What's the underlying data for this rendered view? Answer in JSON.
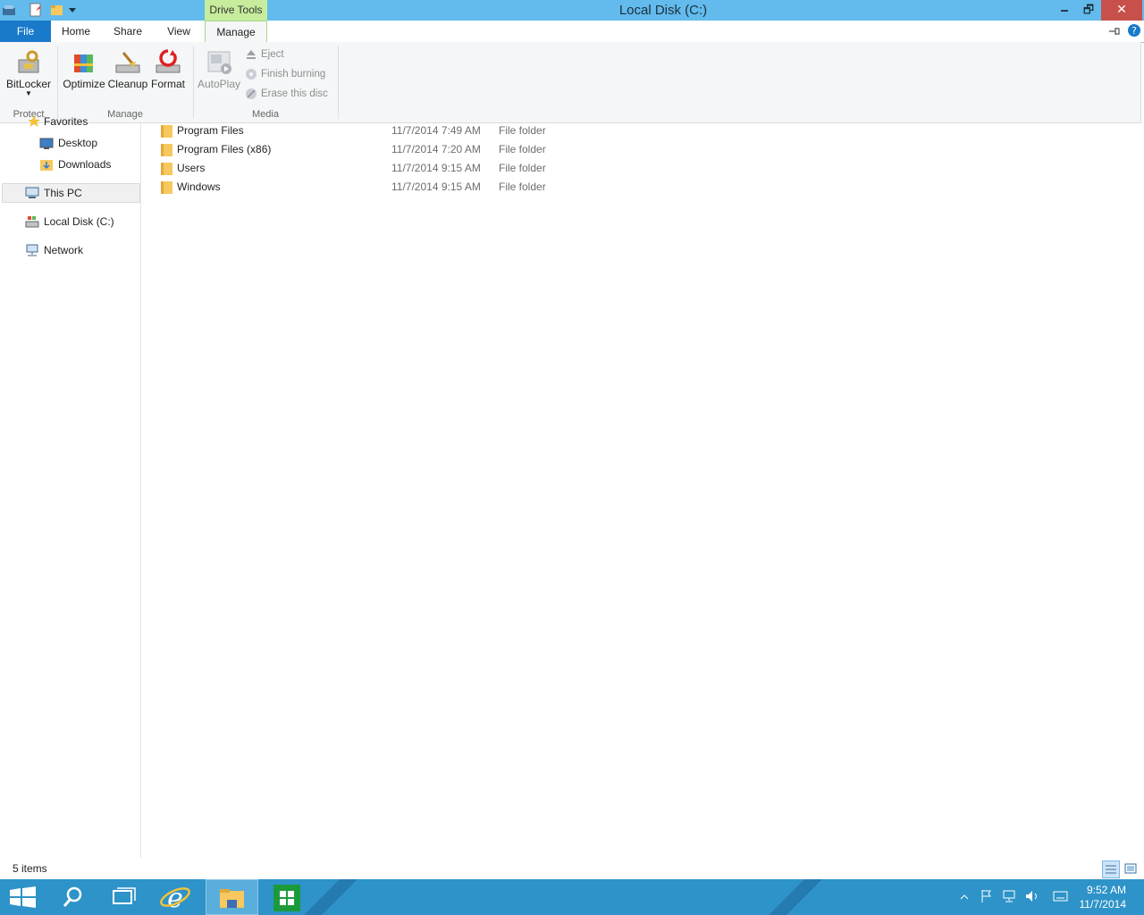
{
  "window": {
    "title": "Local Disk (C:)",
    "context_tab": "Drive Tools",
    "minimize_glyph": "🗕",
    "restore_glyph": "🗗",
    "close_glyph": "✕"
  },
  "ribbon": {
    "tabs": [
      "File",
      "Home",
      "Share",
      "View",
      "Manage"
    ],
    "protect": {
      "label": "Protect",
      "bitlocker": "BitLocker"
    },
    "manage": {
      "label": "Manage",
      "optimize": "Optimize",
      "cleanup": "Cleanup",
      "format": "Format"
    },
    "media": {
      "label": "Media",
      "autoplay": "AutoPlay",
      "eject": "Eject",
      "finish_burning": "Finish burning",
      "erase_disc": "Erase this disc"
    }
  },
  "nav": {
    "favorites": "Favorites",
    "desktop": "Desktop",
    "downloads": "Downloads",
    "thispc": "This PC",
    "localdisk": "Local Disk (C:)",
    "network": "Network"
  },
  "files": [
    {
      "name": "Program Files",
      "date": "11/7/2014 7:49 AM",
      "type": "File folder"
    },
    {
      "name": "Program Files (x86)",
      "date": "11/7/2014 7:20 AM",
      "type": "File folder"
    },
    {
      "name": "Users",
      "date": "11/7/2014 9:15 AM",
      "type": "File folder"
    },
    {
      "name": "Windows",
      "date": "11/7/2014 9:15 AM",
      "type": "File folder"
    }
  ],
  "status": {
    "item_count": "5 items"
  },
  "taskbar": {
    "time": "9:52 AM",
    "date": "11/7/2014"
  },
  "colors": {
    "titlebar": "#62bbec",
    "file_tab": "#1979ca",
    "context": "#c6ec9c",
    "taskbar": "#2e93c8",
    "folder": "#f6c85f"
  }
}
